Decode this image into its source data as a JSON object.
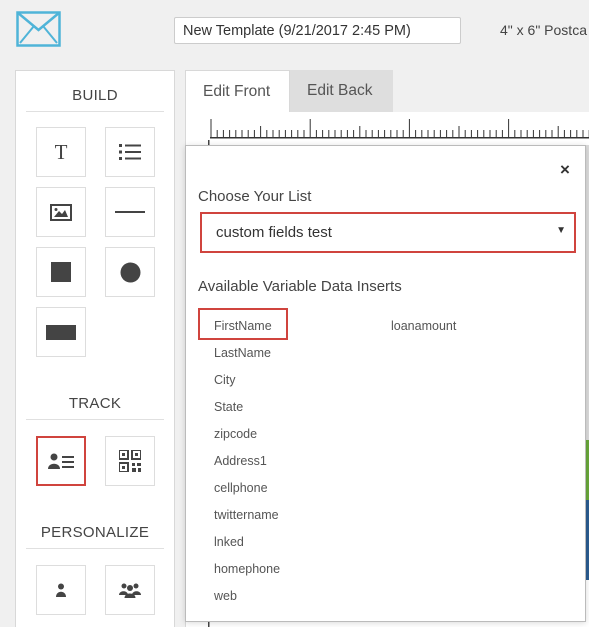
{
  "header": {
    "template_name": "New Template (9/21/2017 2:45 PM)",
    "size_label": "4\" x 6\" Postca"
  },
  "sidebar": {
    "build_title": "BUILD",
    "track_title": "TRACK",
    "personalize_title": "PERSONALIZE",
    "text_tool_glyph": "T"
  },
  "tabs": {
    "front": "Edit Front",
    "back": "Edit Back"
  },
  "modal": {
    "close_glyph": "×",
    "choose_label": "Choose Your List",
    "selected_list": "custom fields test",
    "available_label": "Available Variable Data Inserts",
    "fields_col1": [
      "FirstName",
      "LastName",
      "City",
      "State",
      "zipcode",
      "Address1",
      "cellphone",
      "twittername",
      "lnked",
      "homephone",
      "web"
    ],
    "fields_col2": [
      "loanamount"
    ]
  },
  "colors": {
    "accent": "#d0443e",
    "logo": "#4fb4d8",
    "icon": "#444444"
  },
  "icons": {
    "logo": "envelope-icon",
    "build": [
      "text-icon",
      "list-icon",
      "image-icon",
      "line-icon",
      "square-icon",
      "circle-icon",
      "rectangle-icon"
    ],
    "track": [
      "contact-card-icon",
      "qr-code-icon"
    ],
    "personalize": [
      "person-icon",
      "group-icon"
    ]
  }
}
